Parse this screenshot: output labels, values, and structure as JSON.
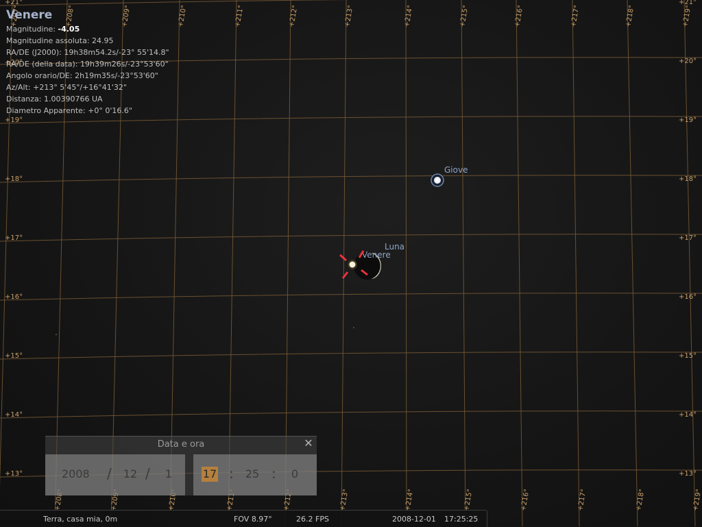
{
  "info": {
    "title": "Venere",
    "magnitude_label": "Magnitudine: ",
    "magnitude_value": "-4.05",
    "abs_magnitude": "Magnitudine assoluta: 24.95",
    "radec_j2000": "RA/DE (J2000): 19h38m54.2s/-23° 55'14.8\"",
    "radec_date": "RA/DE (della data): 19h39m26s/-23°53'60\"",
    "hour_angle": "Angolo orario/DE: 2h19m35s/-23°53'60\"",
    "azalt": "Az/Alt: +213° 5'45\"/+16°41'32\"",
    "distance": "Distanza: 1.00390766 UA",
    "diameter": "Diametro Apparente: +0° 0'16.6\""
  },
  "sky": {
    "grid_color": "#7a5a35",
    "label_color": "#c9a06a",
    "top_az_labels": [
      "+207°",
      "+208°",
      "+209°",
      "+210°",
      "+211°",
      "+212°",
      "+213°",
      "+214°",
      "+215°",
      "+216°",
      "+217°",
      "+218°",
      "+219°"
    ],
    "bottom_az_labels": [
      "+208°",
      "+209°",
      "+210°",
      "+211°",
      "+212°",
      "+213°",
      "+214°",
      "+215°",
      "+216°",
      "+217°",
      "+218°",
      "+219°"
    ],
    "left_alt_labels": [
      "+21°",
      "+20°",
      "+19°",
      "+18°",
      "+17°",
      "+16°",
      "+15°",
      "+14°",
      "+13°"
    ],
    "right_alt_labels": [
      "+21°",
      "+20°",
      "+19°",
      "+18°",
      "+17°",
      "+16°",
      "+15°",
      "+14°",
      "+13°"
    ],
    "objects": {
      "jupiter": "Giove",
      "moon": "Luna",
      "venus": "Venere"
    }
  },
  "datetime_dialog": {
    "title": "Data e ora",
    "close_icon": "close-icon",
    "year": "2008",
    "month": "12",
    "day": "1",
    "hour": "17",
    "minute": "25",
    "second": "0",
    "date_sep": "/",
    "time_sep": ":",
    "highlight_color": "#b5803e"
  },
  "status": {
    "location": "Terra, casa mia, 0m",
    "fov": "FOV 8.97°",
    "fps": "26.2 FPS",
    "date": "2008-12-01",
    "time": "17:25:25"
  }
}
